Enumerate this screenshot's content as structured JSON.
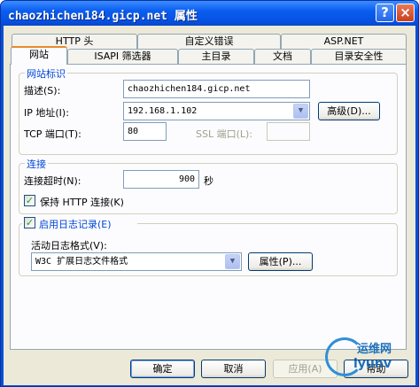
{
  "window": {
    "title": "chaozhichen184.gicp.net 属性",
    "help_glyph": "?",
    "close_glyph": "×"
  },
  "tabs": {
    "row1": [
      "HTTP 头",
      "自定义错误",
      "ASP.NET"
    ],
    "row2": [
      "网站",
      "ISAPI 筛选器",
      "主目录",
      "文档",
      "目录安全性"
    ],
    "active": "网站"
  },
  "site_identity": {
    "legend": "网站标识",
    "description_label": "描述(S):",
    "description_value": "chaozhichen184.gicp.net",
    "ip_label": "IP 地址(I):",
    "ip_value": "192.168.1.102",
    "advanced_button": "高级(D)...",
    "tcp_label": "TCP 端口(T):",
    "tcp_value": "80",
    "ssl_label": "SSL 端口(L):",
    "ssl_value": ""
  },
  "connections": {
    "legend": "连接",
    "timeout_label": "连接超时(N):",
    "timeout_value": "900",
    "timeout_unit": "秒",
    "keepalive_label": "保持 HTTP 连接(K)",
    "keepalive_checked": true
  },
  "logging": {
    "enable_label": "启用日志记录(E)",
    "enable_checked": true,
    "format_label": "活动日志格式(V):",
    "format_value": "W3C 扩展日志文件格式",
    "properties_button": "属性(P)..."
  },
  "footer": {
    "ok": "确定",
    "cancel": "取消",
    "apply": "应用(A)",
    "help": "帮助"
  },
  "watermark": {
    "line1": "运维网",
    "line2": "iyunv"
  },
  "colors": {
    "titlebar": "#0a5ef0",
    "dialog_bg": "#ece9d8",
    "panel_bg": "#fcfcfe",
    "group_legend": "#0046d5",
    "active_tab_accent": "#e68b2c"
  }
}
